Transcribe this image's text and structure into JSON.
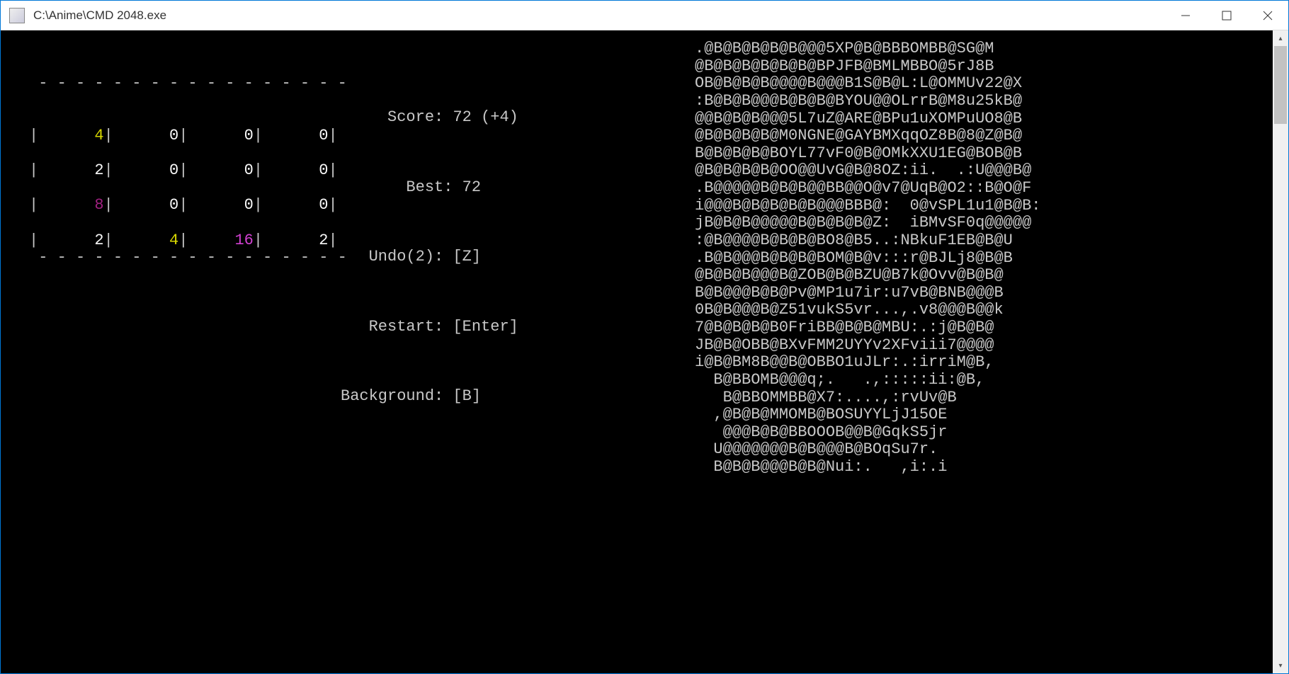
{
  "window": {
    "title": "C:\\Anime\\CMD 2048.exe"
  },
  "game": {
    "board": [
      [
        4,
        0,
        0,
        0
      ],
      [
        2,
        0,
        0,
        0
      ],
      [
        8,
        0,
        0,
        0
      ],
      [
        2,
        4,
        16,
        2
      ]
    ],
    "score": 72,
    "score_delta": 4,
    "best": 72,
    "undo_count": 2,
    "keys": {
      "undo": "Z",
      "restart": "Enter",
      "background": "B"
    },
    "labels": {
      "score": "Score:",
      "best": "Best:",
      "undo": "Undo",
      "restart": "Restart:",
      "background": "Background:"
    }
  },
  "colors": {
    "0": "white",
    "2": "white",
    "4": "yellow",
    "8": "darkmagenta",
    "16": "magenta"
  },
  "ascii_art": [
    ".@B@B@B@B@B@@@5XP@B@BBBOMBB@SG@M",
    "@B@B@B@B@B@B@BPJFB@BMLMBBO@5rJ8B",
    "OB@B@B@B@@@@B@@@B1S@B@L:L@OMMUv22@X",
    ":B@B@B@@@B@B@B@BYOU@@OLrrB@M8u25kB@",
    "@@B@B@B@@@5L7uZ@ARE@BPu1uXOMPuUO8@B",
    "@B@B@B@B@M0NGNE@GAYBMXqqOZ8B@8@Z@B@",
    "B@B@B@B@BOYL77vF0@B@OMkXXU1EG@BOB@B",
    "@B@B@B@B@OO@@UvG@B@8OZ:ii.  .:U@@@B@",
    ".B@@@@@B@B@B@@BB@@O@v7@UqB@O2::B@O@F",
    "i@@@B@B@B@B@B@@@BBB@:  0@vSPL1u1@B@B:",
    "jB@B@B@@@@@B@B@B@B@Z:  iBMvSF0q@@@@@",
    ":@B@@@@B@B@B@BO8@B5..:NBkuF1EB@B@U",
    ".B@B@@@B@B@B@BOM@B@v:::r@BJLj8@B@B",
    "@B@B@B@@@B@ZOB@B@BZU@B7k@Ovv@B@B@",
    "B@B@@@B@B@Pv@MP1u7ir:u7vB@BNB@@@B",
    "0B@B@@@B@Z51vukS5vr...,.v8@@@B@@k",
    "7@B@B@B@B0FriBB@B@B@MBU:.:j@B@B@",
    "JB@B@OBB@BXvFMM2UYYv2XFviii7@@@@",
    "i@B@BM8B@@B@OBBO1uJLr:.:irriM@B,",
    "  B@BBOMB@@@q;.   .,:::::ii:@B,",
    "   B@BBOMMBB@X7:....,:rvUv@B",
    "  ,@B@B@MMOMB@BOSUYYLjJ15OE",
    "   @@@B@B@BBOOOB@@B@GqkS5jr",
    "  U@@@@@@@B@B@@@B@BOqSu7r.",
    "  B@B@B@@@B@B@Nui:.   ,i:.i"
  ]
}
